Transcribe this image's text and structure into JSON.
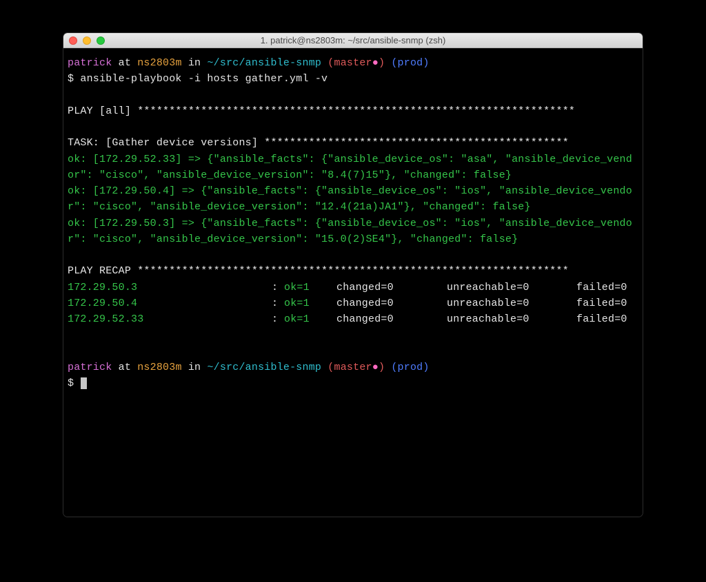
{
  "window": {
    "title": "1. patrick@ns2803m: ~/src/ansible-snmp (zsh)"
  },
  "prompt": {
    "user": "patrick",
    "at": " at ",
    "host": "ns2803m",
    "in_": " in ",
    "path": "~/src/ansible-snmp",
    "branch_open": " (",
    "branch": "master",
    "branch_dirty": "●",
    "branch_close": ")",
    "env_open": " (",
    "env": "prod",
    "env_close": ")",
    "symbol": "$ "
  },
  "command": "ansible-playbook -i hosts gather.yml -v",
  "play_header": "PLAY [all] *********************************************************************",
  "task_header": "TASK: [Gather device versions] ************************************************ ",
  "results": [
    "ok: [172.29.52.33] => {\"ansible_facts\": {\"ansible_device_os\": \"asa\", \"ansible_device_vendor\": \"cisco\", \"ansible_device_version\": \"8.4(7)15\"}, \"changed\": false}",
    "ok: [172.29.50.4] => {\"ansible_facts\": {\"ansible_device_os\": \"ios\", \"ansible_device_vendor\": \"cisco\", \"ansible_device_version\": \"12.4(21a)JA1\"}, \"changed\": false}",
    "ok: [172.29.50.3] => {\"ansible_facts\": {\"ansible_device_os\": \"ios\", \"ansible_device_vendor\": \"cisco\", \"ansible_device_version\": \"15.0(2)SE4\"}, \"changed\": false}"
  ],
  "recap_header": "PLAY RECAP ******************************************************************** ",
  "recap": [
    {
      "host": "172.29.50.3",
      "ok": "ok=1",
      "changed": "changed=0",
      "unreachable": "unreachable=0",
      "failed": "failed=0"
    },
    {
      "host": "172.29.50.4",
      "ok": "ok=1",
      "changed": "changed=0",
      "unreachable": "unreachable=0",
      "failed": "failed=0"
    },
    {
      "host": "172.29.52.33",
      "ok": "ok=1",
      "changed": "changed=0",
      "unreachable": "unreachable=0",
      "failed": "failed=0"
    }
  ]
}
